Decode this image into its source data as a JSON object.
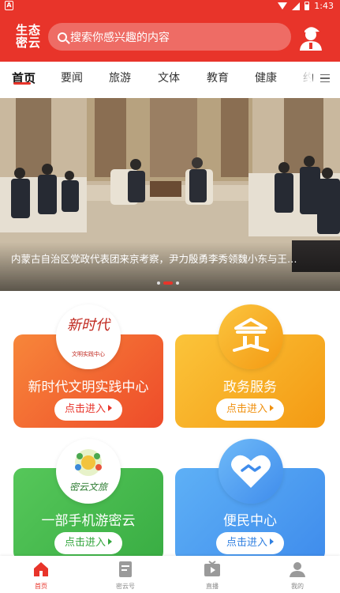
{
  "status_bar": {
    "time": "1:43",
    "notification_icon": "A"
  },
  "header": {
    "logo_line1": "生态",
    "logo_line2": "密云",
    "search_placeholder": "搜索你感兴趣的内容"
  },
  "tabs": [
    "首页",
    "要闻",
    "旅游",
    "文体",
    "教育",
    "健康",
    "约"
  ],
  "banner": {
    "caption": "内蒙古自治区党政代表团来京考察，尹力殷勇李秀领魏小东与王…"
  },
  "cards": [
    {
      "title": "新时代文明实践中心",
      "button": "点击进入",
      "badge_line1": "新时代",
      "badge_line2": "文明实践中心"
    },
    {
      "title": "政务服务",
      "button": "点击进入"
    },
    {
      "title": "一部手机游密云",
      "button": "点击进入",
      "badge_text": "密云文旅"
    },
    {
      "title": "便民中心",
      "button": "点击进入"
    }
  ],
  "bottom_nav": [
    "首页",
    "密云号",
    "直播",
    "我的"
  ],
  "colors": {
    "brand_red": "#e8342a",
    "orange_card": "#f2652f",
    "yellow_card": "#f7a21b",
    "green_card": "#4cbf4e",
    "blue_card": "#4c9bf0"
  }
}
